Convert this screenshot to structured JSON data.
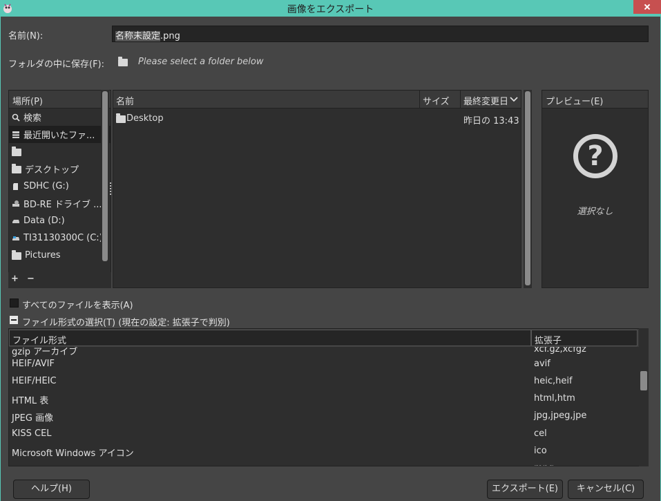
{
  "window": {
    "title": "画像をエクスポート"
  },
  "name_label": "名前(N):",
  "name_value_base": "名称未設定",
  "name_value_ext": ".png",
  "save_in_label": "フォルダの中に保存(F):",
  "save_in_hint": "Please select a folder below",
  "places": {
    "header": "場所(P)",
    "items": [
      {
        "label": "検索",
        "icon": "search-icon"
      },
      {
        "label": "最近開いたファ...",
        "icon": "recent-icon"
      },
      {
        "label": "",
        "icon": "folder-icon"
      },
      {
        "label": "デスクトップ",
        "icon": "folder-icon"
      },
      {
        "label": "SDHC (G:)",
        "icon": "sd-card-icon"
      },
      {
        "label": "BD-RE ドライブ ...",
        "icon": "optical-drive-icon"
      },
      {
        "label": "Data (D:)",
        "icon": "drive-icon"
      },
      {
        "label": "TI31130300C (C:)",
        "icon": "system-drive-icon"
      },
      {
        "label": "Pictures",
        "icon": "folder-icon"
      }
    ],
    "add_label": "+",
    "remove_label": "−"
  },
  "files": {
    "col_name": "名前",
    "col_size": "サイズ",
    "col_modified": "最終変更日",
    "rows": [
      {
        "name": "Desktop",
        "size": "",
        "modified": "昨日の 13:43"
      }
    ]
  },
  "preview": {
    "header": "プレビュー(E)",
    "empty_text": "選択なし"
  },
  "show_all_files_label": "すべてのファイルを表示(A)",
  "file_type_label": "ファイル形式の選択(T) (現在の設定: 拡張子で判別)",
  "types": {
    "col_type": "ファイル形式",
    "col_ext": "拡張子",
    "rows": [
      {
        "type": "gzip アーカイブ",
        "ext": "xcf.gz,xcfgz"
      },
      {
        "type": "HEIF/AVIF",
        "ext": "avif"
      },
      {
        "type": "HEIF/HEIC",
        "ext": "heic,heif"
      },
      {
        "type": "HTML 表",
        "ext": "html,htm"
      },
      {
        "type": "JPEG 画像",
        "ext": "jpg,jpeg,jpe"
      },
      {
        "type": "KISS CEL",
        "ext": "cel"
      },
      {
        "type": "Microsoft Windows アイコン",
        "ext": "ico"
      },
      {
        "type": "MNG 動画",
        "ext": "mng"
      }
    ]
  },
  "buttons": {
    "help": "ヘルプ(H)",
    "export": "エクスポート(E)",
    "cancel": "キャンセル(C)"
  },
  "colors": {
    "titlebar": "#58c8b6",
    "dialog_bg": "#454545",
    "list_bg": "#2e2e2e",
    "close_button": "#c75050"
  }
}
